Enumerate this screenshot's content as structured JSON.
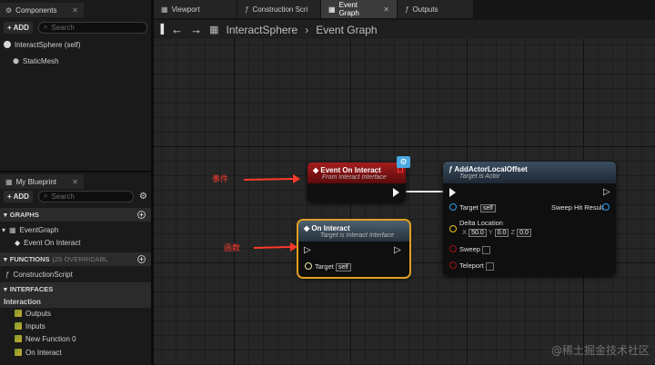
{
  "components_panel": {
    "tab_label": "Components",
    "add_label": "+ ADD",
    "search_placeholder": "Search",
    "items": [
      "InteractSphere (self)",
      "StaticMesh"
    ]
  },
  "blueprint_panel": {
    "tab_label": "My Blueprint",
    "add_label": "+ ADD",
    "search_placeholder": "Search",
    "sections": {
      "graphs": "GRAPHS",
      "functions": "FUNCTIONS",
      "functions_note": "(25 OVERRIDABL",
      "interfaces": "INTERFACES"
    },
    "graph_items": [
      "EventGraph",
      "Event On Interact"
    ],
    "function_items": [
      "ConstructionScript"
    ],
    "interface_group": "Interaction",
    "interface_items": [
      "Outputs",
      "Inputs",
      "New Function 0",
      "On Interact"
    ]
  },
  "doc_tabs": [
    "Viewport",
    "Construction Scri",
    "Event Graph",
    "Outputs"
  ],
  "active_tab": "Event Graph",
  "breadcrumb": [
    "InteractSphere",
    "Event Graph"
  ],
  "nodes": {
    "event_on_interact": {
      "title": "Event On Interact",
      "subtitle": "From Interact Interface"
    },
    "on_interact": {
      "title": "On Interact",
      "subtitle": "Target is Interact Interface",
      "target_label": "Target",
      "target_value": "self"
    },
    "add_actor_local_offset": {
      "title": "AddActorLocalOffset",
      "subtitle": "Target is Actor",
      "target_label": "Target",
      "target_value": "self",
      "delta_label": "Delta Location",
      "x_label": "X",
      "x_value": "50.0",
      "y_label": "Y",
      "y_value": "0.0",
      "z_label": "Z",
      "z_value": "0.0",
      "sweep_label": "Sweep",
      "teleport_label": "Teleport",
      "sweep_hit_label": "Sweep Hit Result"
    }
  },
  "annotations": {
    "event": "事件",
    "function": "函数"
  },
  "watermark": "@稀土掘金技术社区",
  "colors": {
    "event_header": "#8a1212",
    "function_header": "#2c3a4a",
    "selected_outline": "#e0a020",
    "annotation": "#ff3a2a",
    "vector_pin": "#f0c020",
    "object_pin": "#2c9cf0",
    "bool_pin": "#8a0e0e"
  }
}
